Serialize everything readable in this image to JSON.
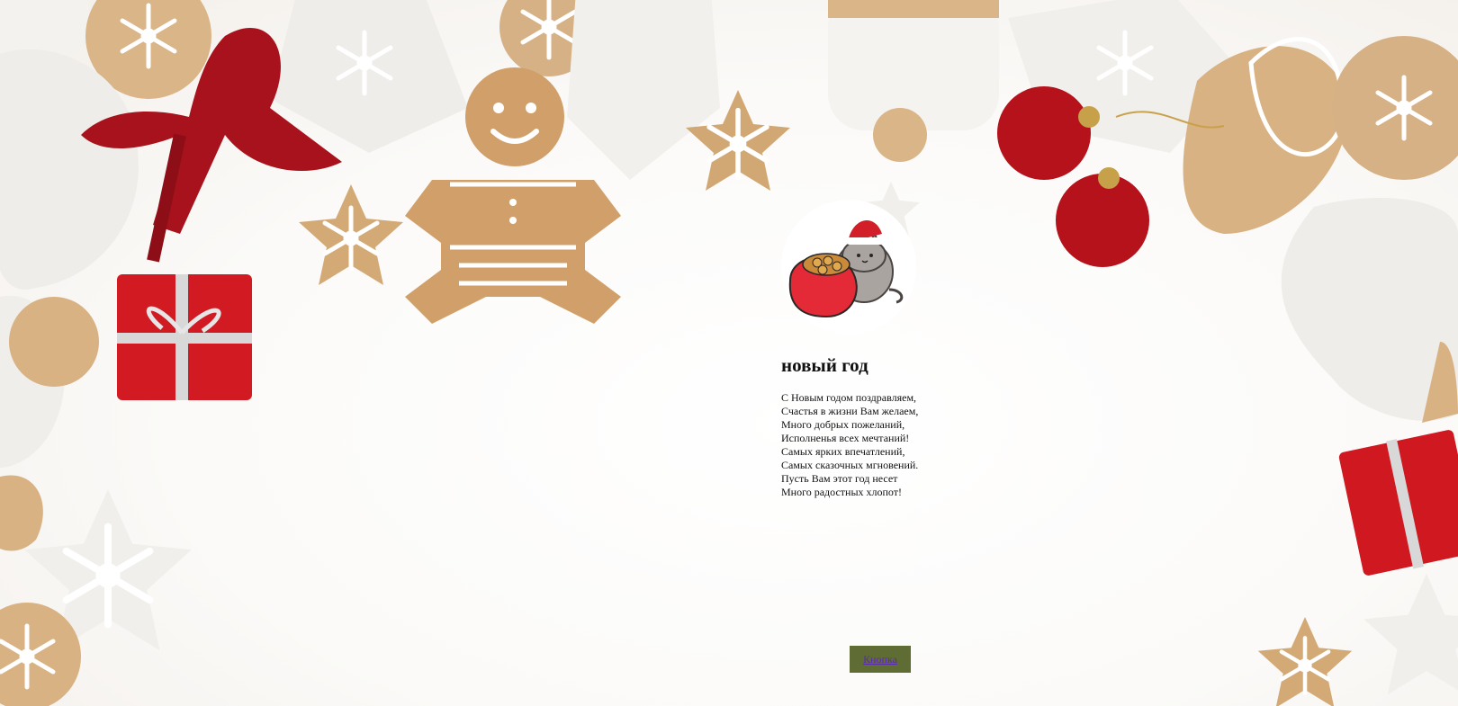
{
  "page": {
    "title": "новый год",
    "poem_lines": [
      "С Новым годом поздравляем,",
      "Счастья в жизни Вам желаем,",
      "Много добрых пожеланий,",
      "Исполненья всех мечтаний!",
      "Самых ярких впечатлений,",
      "Самых сказочных мгновений.",
      "Пусть Вам этот год несет",
      "Много радостных хлопот!"
    ],
    "button_label": "Кнопка"
  },
  "images": {
    "background": "gingerbread-cookies-christmas-background",
    "avatar": "pusheen-cat-with-santa-hat-and-gift-bag"
  },
  "colors": {
    "button_bg": "#5f6d34",
    "link_text": "#5a2ab0",
    "text": "#111111",
    "page_bg": "#ffffff"
  }
}
